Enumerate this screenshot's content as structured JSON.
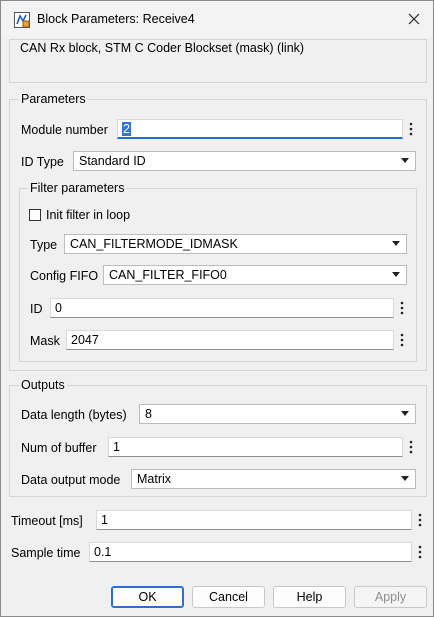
{
  "window": {
    "title": "Block Parameters: Receive4"
  },
  "description": {
    "text": "CAN Rx block, STM C Coder Blockset (mask) (link)"
  },
  "parameters": {
    "heading": "Parameters",
    "module_number": {
      "label": "Module number",
      "value": "2"
    },
    "id_type": {
      "label": "ID Type",
      "value": "Standard ID"
    },
    "filter": {
      "heading": "Filter parameters",
      "init_in_loop": {
        "label": "Init filter in loop",
        "checked": false
      },
      "type": {
        "label": "Type",
        "value": "CAN_FILTERMODE_IDMASK"
      },
      "config_fifo": {
        "label": "Config FIFO",
        "value": "CAN_FILTER_FIFO0"
      },
      "id": {
        "label": "ID",
        "value": "0"
      },
      "mask": {
        "label": "Mask",
        "value": "2047"
      }
    }
  },
  "outputs": {
    "heading": "Outputs",
    "data_length": {
      "label": "Data length (bytes)",
      "value": "8"
    },
    "num_buffer": {
      "label": "Num of buffer",
      "value": "1"
    },
    "data_output_mode": {
      "label": "Data output mode",
      "value": "Matrix"
    }
  },
  "timeout": {
    "label": "Timeout [ms]",
    "value": "1"
  },
  "sample_time": {
    "label": "Sample time",
    "value": "0.1"
  },
  "buttons": {
    "ok": "OK",
    "cancel": "Cancel",
    "help": "Help",
    "apply": "Apply"
  },
  "colors": {
    "focus": "#1a73c8",
    "selection": "#3375d6",
    "default_button": "#2c6fcf"
  }
}
